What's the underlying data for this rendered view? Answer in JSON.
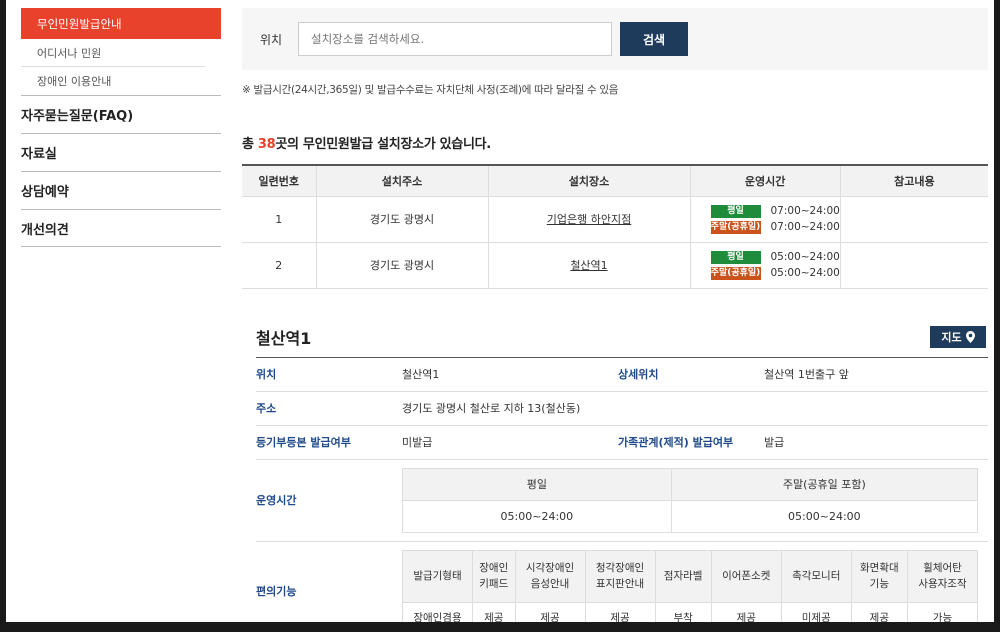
{
  "sidebar": {
    "active": "무인민원발급안내",
    "subs": [
      "어디서나 민원",
      "장애인 이용안내"
    ],
    "mains": [
      "자주묻는질문(FAQ)",
      "자료실",
      "상담예약",
      "개선의견"
    ]
  },
  "search": {
    "label": "위치",
    "placeholder": "설치장소를 검색하세요.",
    "button": "검색"
  },
  "notice": "※ 발급시간(24시간,365일) 및 발급수수료는 자치단체 사정(조례)에 따라 달라질 수 있음",
  "total": {
    "prefix": "총 ",
    "count": "38",
    "suffix": "곳의 무인민원발급 설치장소가 있습니다."
  },
  "list": {
    "headers": [
      "일련번호",
      "설치주소",
      "설치장소",
      "운영시간",
      "참고내용"
    ],
    "badge_weekday": "평일",
    "badge_weekend": "주말(공휴일)",
    "rows": [
      {
        "no": "1",
        "addr": "경기도 광명시",
        "place": "기업은행 하안지점",
        "weekday": "07:00~24:00",
        "weekend": "07:00~24:00",
        "note": ""
      },
      {
        "no": "2",
        "addr": "경기도 광명시",
        "place": "철산역1",
        "weekday": "05:00~24:00",
        "weekend": "05:00~24:00",
        "note": ""
      }
    ]
  },
  "detail": {
    "title": "철산역1",
    "map_button": "지도",
    "loc_label": "위치",
    "loc_value": "철산역1",
    "detail_loc_label": "상세위치",
    "detail_loc_value": "철산역 1번출구 앞",
    "addr_label": "주소",
    "addr_value": "경기도 광명시 철산로 지하 13(철산동)",
    "reg_label": "등기부등본 발급여부",
    "reg_value": "미발급",
    "family_label": "가족관계(제적) 발급여부",
    "family_value": "발급",
    "hours_label": "운영시간",
    "hours_headers": [
      "평일",
      "주말(공휴일 포함)"
    ],
    "hours_values": [
      "05:00~24:00",
      "05:00~24:00"
    ],
    "conv_label": "편의기능",
    "conv_headers": [
      "발급기형태",
      "장애인\n키패드",
      "시각장애인\n음성안내",
      "청각장애인\n표지판안내",
      "점자라벨",
      "이어폰소켓",
      "촉각모니터",
      "화면확대\n기능",
      "휠체어탄\n사용자조작"
    ],
    "conv_values": [
      "장애인겸용",
      "제공",
      "제공",
      "제공",
      "부착",
      "제공",
      "미제공",
      "제공",
      "가능"
    ]
  },
  "colors": {
    "accent": "#e8422d",
    "navy": "#1f3b5c",
    "label_blue": "#1f4a8a"
  }
}
